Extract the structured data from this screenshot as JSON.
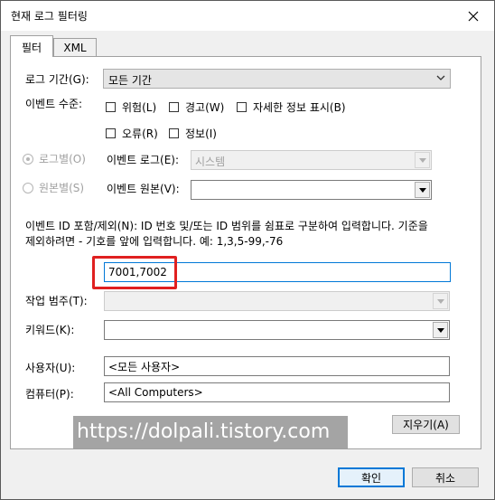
{
  "window": {
    "title": "현재 로그 필터링",
    "close_label": "✕"
  },
  "tabs": [
    {
      "label": "필터",
      "active": true
    },
    {
      "label": "XML",
      "active": false
    }
  ],
  "log_period": {
    "label": "로그 기간(G):",
    "value": "모든 기간"
  },
  "event_level": {
    "label": "이벤트 수준:",
    "options": [
      {
        "label": "위험(L)",
        "checked": false
      },
      {
        "label": "경고(W)",
        "checked": false
      },
      {
        "label": "자세한 정보 표시(B)",
        "checked": false
      },
      {
        "label": "오류(R)",
        "checked": false
      },
      {
        "label": "정보(I)",
        "checked": false
      }
    ]
  },
  "by_log": {
    "label": "로그별(O)",
    "selected": true
  },
  "by_source": {
    "label": "원본별(S)",
    "selected": false
  },
  "event_log": {
    "label": "이벤트 로그(E):",
    "value": "시스템"
  },
  "event_source": {
    "label": "이벤트 원본(V):",
    "value": ""
  },
  "event_id": {
    "description_line1": "이벤트 ID 포함/제외(N): ID 번호 및/또는 ID 범위를 쉼표로 구분하여 입력합니다. 기준을",
    "description_line2": "제외하려면 - 기호를 앞에 입력합니다. 예: 1,3,5-99,-76",
    "value": "7001,7002"
  },
  "task_category": {
    "label": "작업 범주(T):",
    "value": ""
  },
  "keywords": {
    "label": "키워드(K):",
    "value": ""
  },
  "user": {
    "label": "사용자(U):",
    "value": "<모든 사용자>"
  },
  "computer": {
    "label": "컴퓨터(P):",
    "value": "<All Computers>"
  },
  "buttons": {
    "clear": "지우기(A)",
    "ok": "확인",
    "cancel": "취소"
  },
  "watermark": "https://dolpali.tistory.com",
  "colors": {
    "accent": "#0078d7",
    "highlight": "#e02020"
  }
}
